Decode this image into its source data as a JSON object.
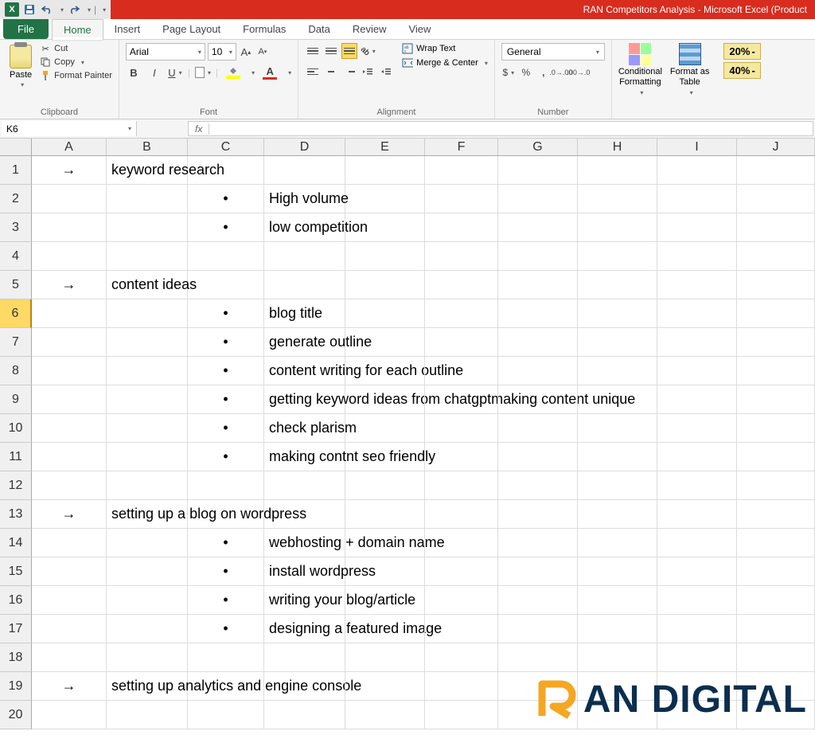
{
  "app": {
    "title": "RAN Competitors Analysis - Microsoft Excel (Product"
  },
  "tabs": {
    "file": "File",
    "items": [
      "Home",
      "Insert",
      "Page Layout",
      "Formulas",
      "Data",
      "Review",
      "View"
    ],
    "active": "Home"
  },
  "ribbon": {
    "clipboard": {
      "title": "Clipboard",
      "paste": "Paste",
      "cut": "Cut",
      "copy": "Copy",
      "painter": "Format Painter"
    },
    "font": {
      "title": "Font",
      "name": "Arial",
      "size": "10"
    },
    "alignment": {
      "title": "Alignment",
      "wrap": "Wrap Text",
      "merge": "Merge & Center"
    },
    "number": {
      "title": "Number",
      "format": "General"
    },
    "styles": {
      "conditional": "Conditional\nFormatting",
      "formatTable": "Format as\nTable"
    },
    "pct": {
      "p20": "20%",
      "p40": "40%"
    }
  },
  "nameBox": "K6",
  "columns": [
    "A",
    "B",
    "C",
    "D",
    "E",
    "F",
    "G",
    "H",
    "I",
    "J"
  ],
  "rows": [
    {
      "n": "1",
      "A": "→",
      "B": "keyword research"
    },
    {
      "n": "2",
      "C": "•",
      "D": "High volume"
    },
    {
      "n": "3",
      "C": "•",
      "D": "low competition"
    },
    {
      "n": "4"
    },
    {
      "n": "5",
      "A": "→",
      "B": "content ideas"
    },
    {
      "n": "6",
      "C": "•",
      "D": "blog title"
    },
    {
      "n": "7",
      "C": "•",
      "D": "generate outline"
    },
    {
      "n": "8",
      "C": "•",
      "D": "content writing for each outline"
    },
    {
      "n": "9",
      "C": "•",
      "D": "getting keyword ideas from chatgptmaking content unique"
    },
    {
      "n": "10",
      "C": "•",
      "D": "check  plarism"
    },
    {
      "n": "11",
      "C": "•",
      "D": "making contnt seo friendly"
    },
    {
      "n": "12"
    },
    {
      "n": "13",
      "A": "→",
      "B": "setting up a blog on wordpress"
    },
    {
      "n": "14",
      "C": "•",
      "D": "webhosting + domain name"
    },
    {
      "n": "15",
      "C": "•",
      "D": "install wordpress"
    },
    {
      "n": "16",
      "C": "•",
      "D": "writing your blog/article"
    },
    {
      "n": "17",
      "C": "•",
      "D": "designing a featured image"
    },
    {
      "n": "18"
    },
    {
      "n": "19",
      "A": "→",
      "B": "setting up analytics and engine console"
    },
    {
      "n": "20"
    }
  ],
  "selectedRow": "6",
  "watermark": "AN DIGITAL"
}
